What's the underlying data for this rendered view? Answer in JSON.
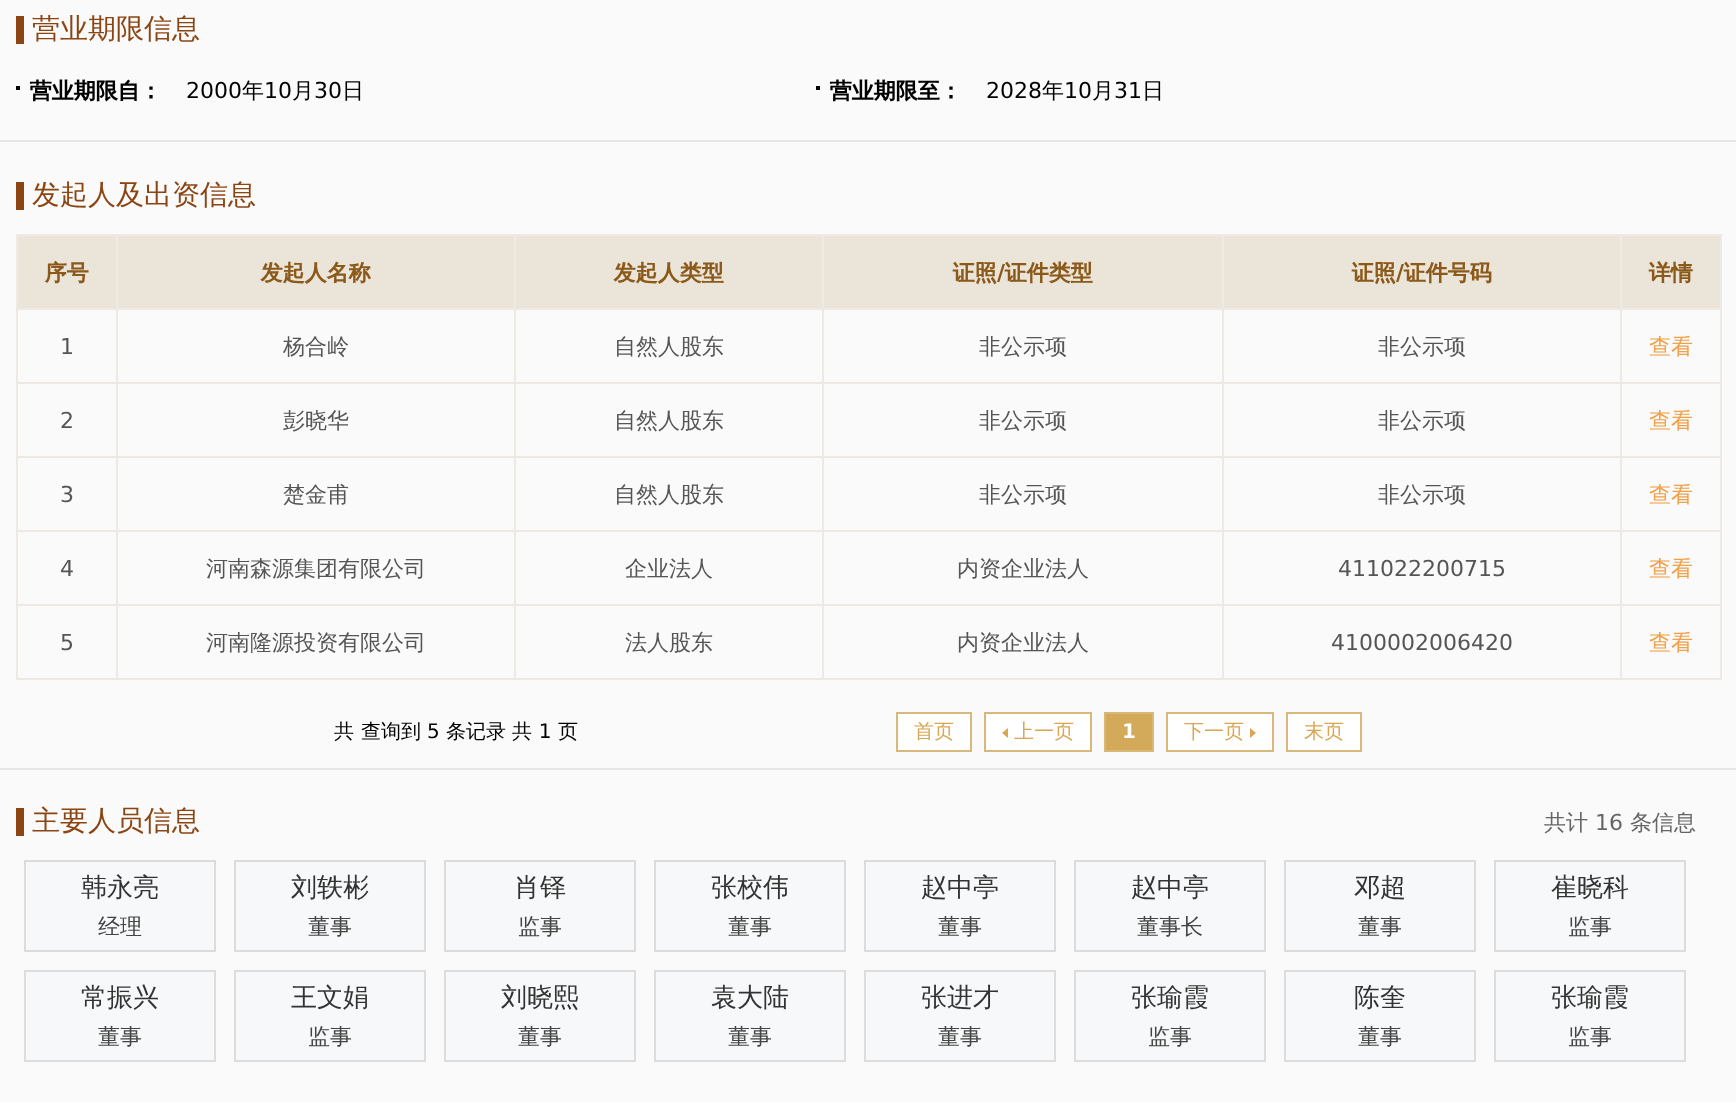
{
  "business_term": {
    "title": "营业期限信息",
    "fields": [
      {
        "label": "营业期限自：",
        "value": "2000年10月30日"
      },
      {
        "label": "营业期限至：",
        "value": "2028年10月31日"
      }
    ]
  },
  "investors": {
    "title": "发起人及出资信息",
    "columns": [
      "序号",
      "发起人名称",
      "发起人类型",
      "证照/证件类型",
      "证照/证件号码",
      "详情"
    ],
    "rows": [
      {
        "cells": [
          "1",
          "杨合岭",
          "自然人股东",
          "非公示项",
          "非公示项"
        ],
        "link": "查看"
      },
      {
        "cells": [
          "2",
          "彭晓华",
          "自然人股东",
          "非公示项",
          "非公示项"
        ],
        "link": "查看"
      },
      {
        "cells": [
          "3",
          "楚金甫",
          "自然人股东",
          "非公示项",
          "非公示项"
        ],
        "link": "查看"
      },
      {
        "cells": [
          "4",
          "河南森源集团有限公司",
          "企业法人",
          "内资企业法人",
          "411022200715"
        ],
        "link": "查看"
      },
      {
        "cells": [
          "5",
          "河南隆源投资有限公司",
          "法人股东",
          "内资企业法人",
          "4100002006420"
        ],
        "link": "查看"
      }
    ],
    "summary": "共 查询到 5 条记录 共 1 页",
    "pager": [
      {
        "label": "首页",
        "kind": "plain",
        "selected": false
      },
      {
        "label": "上一页",
        "kind": "prev",
        "selected": false
      },
      {
        "label": "1",
        "kind": "page",
        "selected": true
      },
      {
        "label": "下一页",
        "kind": "next",
        "selected": false
      },
      {
        "label": "末页",
        "kind": "plain",
        "selected": false
      }
    ]
  },
  "staff": {
    "title": "主要人员信息",
    "total": "共计 16 条信息",
    "people": [
      {
        "name": "韩永亮",
        "role": "经理"
      },
      {
        "name": "刘轶彬",
        "role": "董事"
      },
      {
        "name": "肖铎",
        "role": "监事"
      },
      {
        "name": "张校伟",
        "role": "董事"
      },
      {
        "name": "赵中亭",
        "role": "董事"
      },
      {
        "name": "赵中亭",
        "role": "董事长"
      },
      {
        "name": "邓超",
        "role": "董事"
      },
      {
        "name": "崔晓科",
        "role": "监事"
      },
      {
        "name": "常振兴",
        "role": "董事"
      },
      {
        "name": "王文娟",
        "role": "监事"
      },
      {
        "name": "刘晓熙",
        "role": "董事"
      },
      {
        "name": "袁大陆",
        "role": "董事"
      },
      {
        "name": "张进才",
        "role": "董事"
      },
      {
        "name": "张瑜霞",
        "role": "监事"
      },
      {
        "name": "陈奎",
        "role": "董事"
      },
      {
        "name": "张瑜霞",
        "role": "监事"
      }
    ]
  }
}
